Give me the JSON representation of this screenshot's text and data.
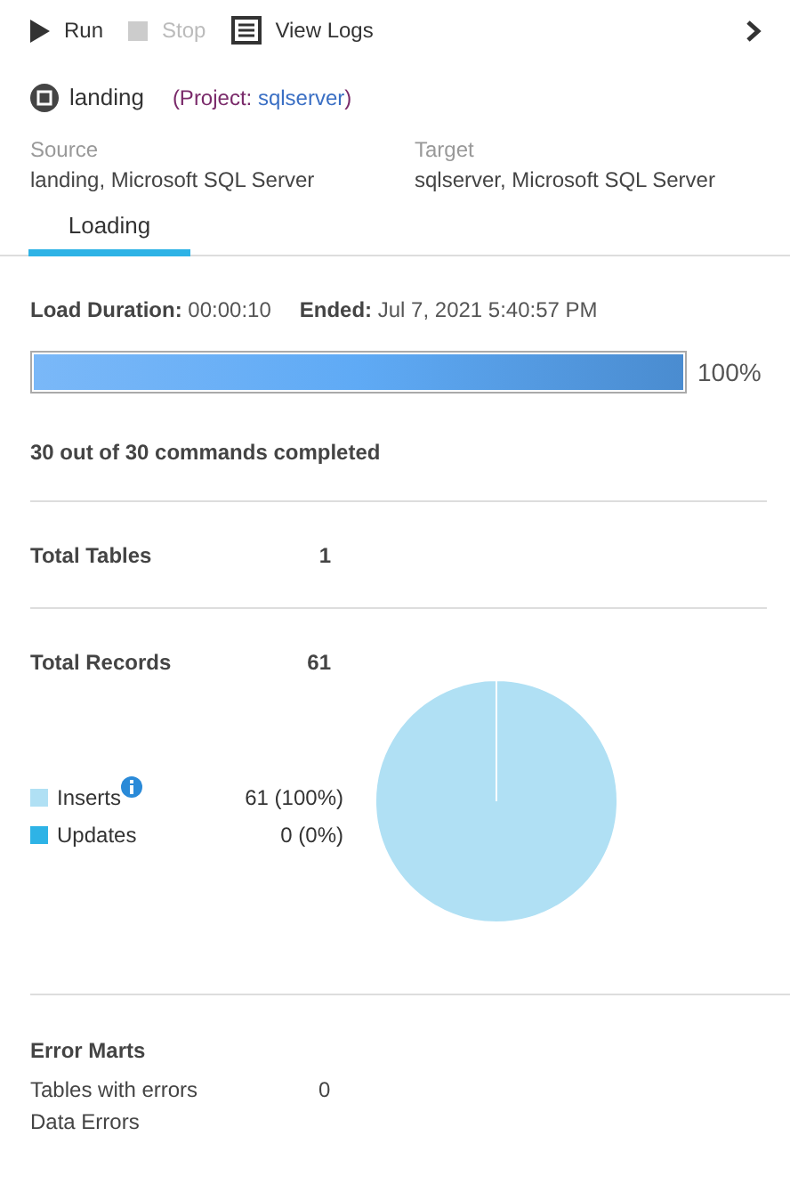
{
  "toolbar": [
    {
      "kind": "run",
      "label": "Run",
      "disabled": false
    },
    {
      "kind": "stop",
      "label": "Stop",
      "disabled": true
    },
    {
      "kind": "logs",
      "label": "View Logs",
      "disabled": false
    }
  ],
  "task": {
    "name": "landing",
    "project_prefix": "(Project: ",
    "project": "sqlserver",
    "project_suffix": ")"
  },
  "endpoints": [
    {
      "label": "Source",
      "value": "landing, Microsoft SQL Server"
    },
    {
      "label": "Target",
      "value": "sqlserver, Microsoft SQL Server"
    }
  ],
  "tabs": [
    {
      "label": "Loading",
      "selected": true
    }
  ],
  "summary": [
    {
      "label": "Load Duration:",
      "value": "00:00:10"
    },
    {
      "label": "Ended:",
      "value": "Jul 7, 2021 5:40:57 PM"
    }
  ],
  "progress": {
    "level": 1,
    "reading": "100%"
  },
  "commands": "30 out of 30 commands completed",
  "total_tables": {
    "label": "Total Tables",
    "value": "1"
  },
  "total_records": {
    "label": "Total Records",
    "value": "61"
  },
  "legend": [
    {
      "value": "61 (100%)",
      "color": "#b0e0f4",
      "info": true
    },
    {
      "value": "0 (0%)",
      "color": "#2eb3e6",
      "info": false
    }
  ],
  "chart_data": {
    "type": "pie",
    "categories": [
      "Inserts",
      "Updates"
    ],
    "values": [
      100,
      0
    ]
  },
  "error_marts": {
    "title": "Error Marts",
    "rows": [
      {
        "label": "Tables with errors",
        "value": "0"
      },
      {
        "label": "Data Errors"
      }
    ]
  }
}
